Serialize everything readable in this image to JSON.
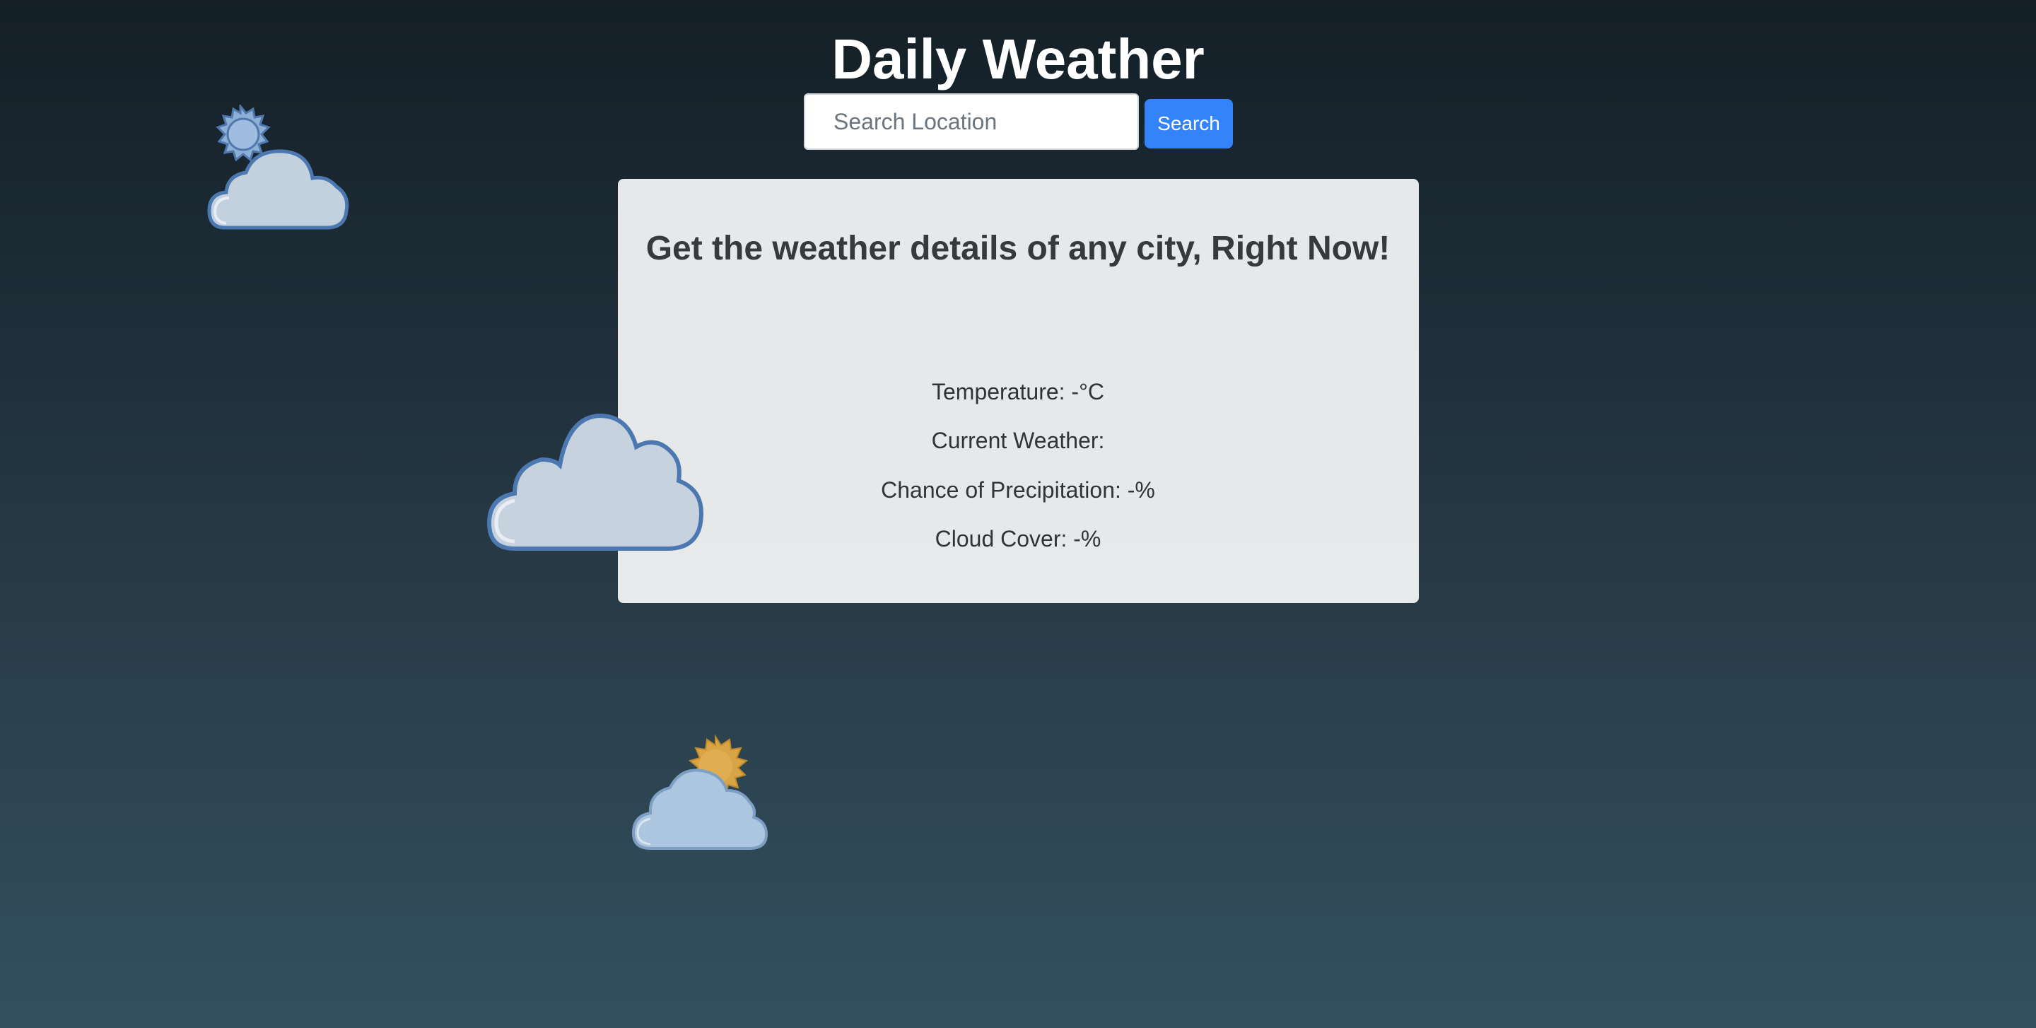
{
  "header": {
    "title": "Daily Weather"
  },
  "search": {
    "placeholder": "Search Location",
    "value": "",
    "button_label": "Search"
  },
  "card": {
    "heading": "Get the weather details of any city, Right Now!",
    "details": [
      "Temperature: -°C",
      "Current Weather:",
      "Chance of Precipitation: -%",
      "Cloud Cover: -%"
    ]
  },
  "decorations": {
    "icons": [
      "partly-cloudy-blue-sun-icon",
      "cloud-icon",
      "partly-cloudy-gold-sun-icon"
    ]
  },
  "colors": {
    "accent": "#3583f8",
    "background_top": "#141f27",
    "background_bottom": "#33505f",
    "card": "#edeef0",
    "text": "#343a3d"
  }
}
